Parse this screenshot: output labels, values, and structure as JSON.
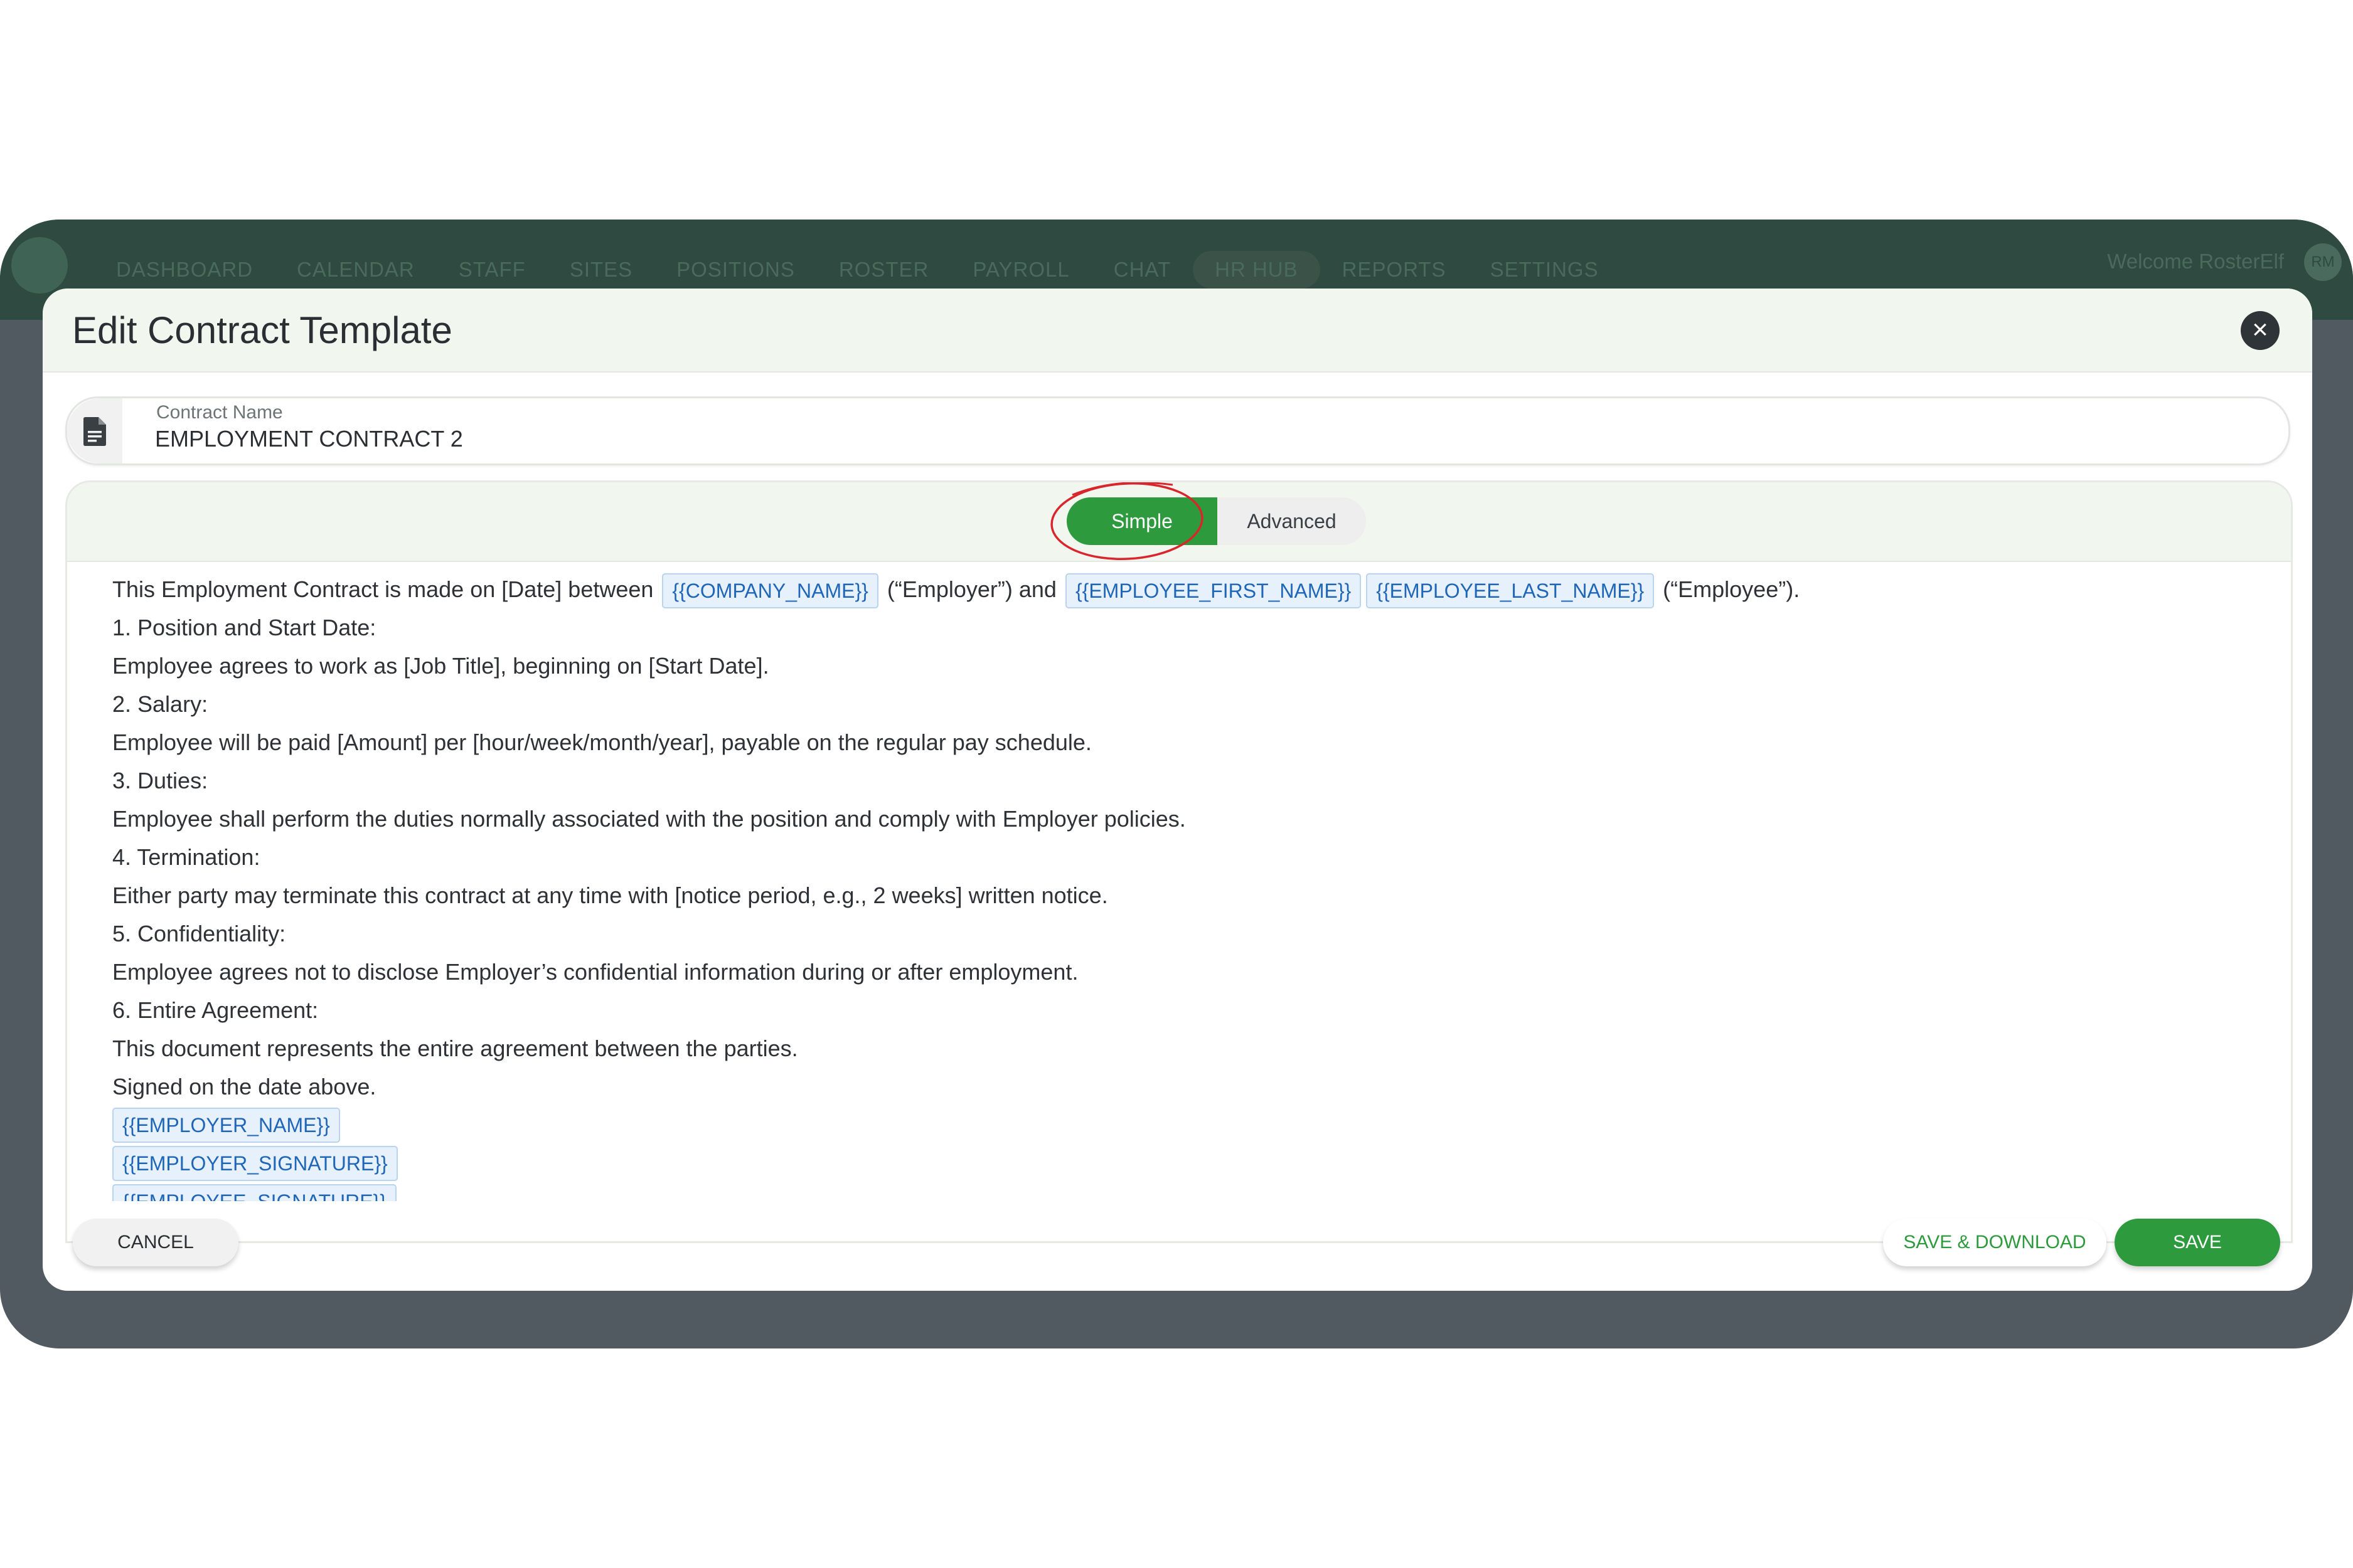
{
  "app": {
    "nav_items": [
      "DASHBOARD",
      "CALENDAR",
      "STAFF",
      "SITES",
      "POSITIONS",
      "ROSTER",
      "PAYROLL",
      "CHAT",
      "HR HUB",
      "REPORTS",
      "SETTINGS"
    ],
    "active_nav": "HR HUB",
    "welcome": "Welcome RosterElf",
    "avatar_initials": "RM"
  },
  "modal": {
    "title": "Edit Contract Template",
    "close_icon": "close-icon"
  },
  "contract_name": {
    "label": "Contract Name",
    "value": "EMPLOYMENT CONTRACT 2",
    "icon": "document-icon"
  },
  "mode_toggle": {
    "simple_label": "Simple",
    "advanced_label": "Advanced",
    "selected": "Simple"
  },
  "document": {
    "intro": {
      "t1": "This Employment Contract is made on [Date] between",
      "token1": "{{COMPANY_NAME}}",
      "t2": "(“Employer”) and",
      "token2": "{{EMPLOYEE_FIRST_NAME}}",
      "token3": "{{EMPLOYEE_LAST_NAME}}",
      "t3": "(“Employee”)."
    },
    "lines": [
      "1. Position and Start Date:",
      "Employee agrees to work as [Job Title], beginning on [Start Date].",
      "2. Salary:",
      "Employee will be paid [Amount] per [hour/week/month/year], payable on the regular pay schedule.",
      "3. Duties:",
      "Employee shall perform the duties normally associated with the position and comply with Employer policies.",
      "4. Termination:",
      "Either party may terminate this contract at any time with [notice period, e.g., 2 weeks] written notice.",
      "5. Confidentiality:",
      "Employee agrees not to disclose Employer’s confidential information during or after employment.",
      "6. Entire Agreement:",
      "This document represents the entire agreement between the parties.",
      "Signed on the date above."
    ],
    "signature_tokens": [
      "{{EMPLOYER_NAME}}",
      "{{EMPLOYER_SIGNATURE}}",
      "{{EMPLOYEE_SIGNATURE}}"
    ]
  },
  "footer": {
    "cancel_label": "CANCEL",
    "save_download_label": "SAVE & DOWNLOAD",
    "save_label": "SAVE"
  },
  "colors": {
    "primary_green": "#2d9a3e",
    "header_tint": "#f1f6ef",
    "token_blue": "#1f66b8",
    "annotation_red": "#d9262c"
  }
}
